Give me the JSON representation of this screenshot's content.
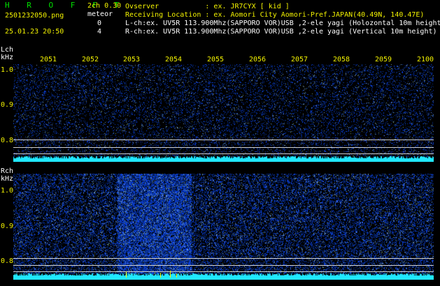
{
  "header": {
    "brand": "H R O F F T",
    "version": "2ch 0.30",
    "file_name": "2501232050.png",
    "column_label": "meteor",
    "timestamp": "25.01.23 20:50",
    "lch_count": "0",
    "rch_count": "4"
  },
  "station": {
    "observer": "Ovserver           : ex. JR7CYX [ kid ]",
    "location": "Receiving Location : ex. Aomori City Aomori-Pref.JAPAN(40.49N, 140.47E)",
    "lch_info": "L-ch:ex. UV5R 113.900Mhz(SAPPORO VOR)USB ,2-ele yagi (Holozontal 10m height)",
    "rch_info": "R-ch:ex. UV5R 113.900Mhz(SAPPORO VOR)USB ,2-ele yagi (Vertical 10m height)"
  },
  "time_axis": [
    "2051",
    "2052",
    "2053",
    "2054",
    "2055",
    "2056",
    "2057",
    "2058",
    "2059",
    "2100"
  ],
  "lch": {
    "label": "Lch",
    "unit": "kHz",
    "freq_ticks": [
      "1.0",
      "0.9",
      "0.8"
    ]
  },
  "rch": {
    "label": "Rch",
    "unit": "kHz",
    "freq_ticks": [
      "1.0",
      "0.9",
      "0.8"
    ]
  },
  "colors": {
    "noise": "#0a28d0",
    "signal": "#20e8ff",
    "marker": "#f2f200",
    "accent": "#00e000"
  }
}
